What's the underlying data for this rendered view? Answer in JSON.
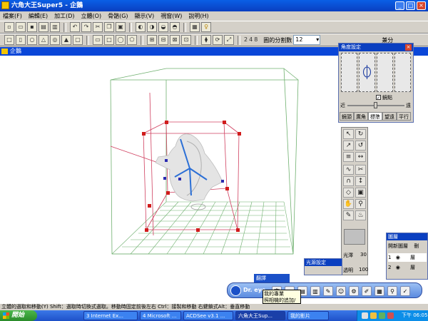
{
  "app": {
    "title": "六角大王Super5 - 企鵝"
  },
  "window_buttons": {
    "minimize": "_",
    "maximize": "□",
    "close": "×"
  },
  "menu": [
    "檔案(F)",
    "編輯(E)",
    "加工(D)",
    "立體(O)",
    "骨骼(G)",
    "顯示(V)",
    "視窗(W)",
    "說明(H)"
  ],
  "toolbar2": {
    "numbers": [
      "2",
      "4",
      "8"
    ],
    "segment_label": "圓的分割數",
    "segment_value": "12",
    "right_label": "兼分"
  },
  "document": {
    "title": "企鵝"
  },
  "angle_panel": {
    "title": "角度設定",
    "checkbox_label": "鏡點",
    "near_label": "近",
    "far_label": "遠",
    "tabs": [
      "鏡頭",
      "廣角",
      "標準",
      "望遠",
      "平行"
    ],
    "active_tab": "標準"
  },
  "tool_palette": {
    "gloss_label": "光澤",
    "gloss_value": "30",
    "transparency_label": "透明",
    "transparency_value": "100",
    "icons": [
      "↖",
      "↻",
      "↗",
      "↺",
      "≡",
      "↔",
      "∿",
      "✂",
      "∩",
      "↕",
      "◇",
      "▣",
      "☐",
      "◍",
      "✋",
      "🔍",
      "✎",
      "✋"
    ]
  },
  "layer_panel": {
    "title": "圖層",
    "headers": [
      "開新圖層",
      "刪"
    ],
    "rows": [
      {
        "num": "1",
        "name": "層"
      },
      {
        "num": "2",
        "name": "層"
      }
    ]
  },
  "light_panel": {
    "title": "光源設定"
  },
  "dreye": {
    "label": "Dr. eye",
    "tab": "翻譯"
  },
  "tooltip": {
    "line1": "我的專業",
    "line2": "照相機的追加/刪除"
  },
  "status": {
    "text": "立體的選取和移動(Y)  Shift：選取時切換式選取。移動時固定前後左右  Ctrl：接製和移動  右鍵鎖式Alt：垂直移動"
  },
  "taskbar": {
    "start": "開始",
    "tasks": [
      "3 Internet Ex...",
      "4 Microsoft ...",
      "ACDSee v3.1 ...",
      "六角大王Sup...",
      "我的影片"
    ],
    "active_task": "六角大王Sup...",
    "clock": "下午 06:05"
  }
}
